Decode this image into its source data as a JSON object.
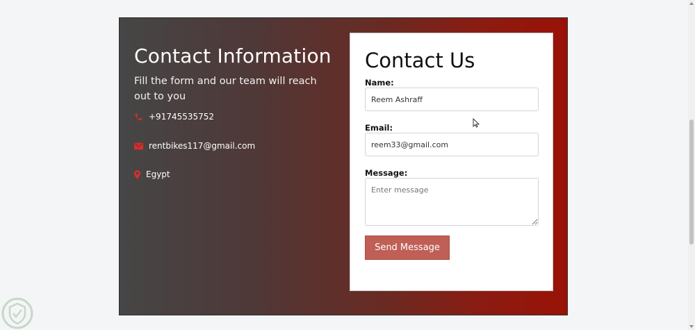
{
  "contact_info": {
    "title": "Contact Information",
    "subtitle": "Fill the form and our team will reach out to you",
    "phone": "+91745535752",
    "email": "rentbikes117@gmail.com",
    "location": "Egypt",
    "icon_color": "#d32f2f",
    "icons": [
      "phone-icon",
      "envelope-icon",
      "map-marker-icon"
    ]
  },
  "form": {
    "title": "Contact Us",
    "name_label": "Name:",
    "name_value": "Reem Ashraff",
    "email_label": "Email:",
    "email_value": "reem33@gmail.com",
    "message_label": "Message:",
    "message_placeholder": "Enter message",
    "submit_label": "Send Message",
    "submit_color": "#bf5f56"
  },
  "colors": {
    "gradient_start": "#464646",
    "gradient_end": "#9a1207",
    "page_background": "#f4f5f7"
  }
}
